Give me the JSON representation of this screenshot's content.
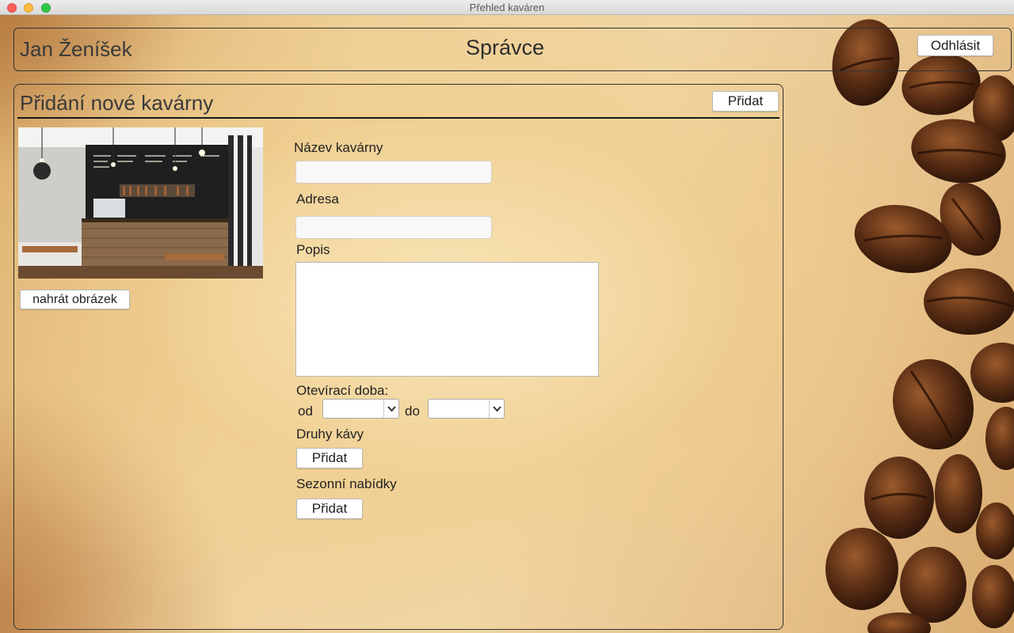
{
  "window": {
    "title": "Přehled kaváren"
  },
  "header": {
    "user_name": "Jan Ženíšek",
    "role": "Správce",
    "logout_label": "Odhlásit"
  },
  "form": {
    "title": "Přidání nové kavárny",
    "add_label": "Přidat",
    "upload_label": "nahrát obrázek",
    "name_label": "Název kavárny",
    "name_value": "",
    "address_label": "Adresa",
    "address_value": "",
    "description_label": "Popis",
    "description_value": "",
    "hours_label": "Otevírací doba:",
    "from_label": "od",
    "to_label": "do",
    "from_value": "",
    "to_value": "",
    "coffee_types_label": "Druhy kávy",
    "coffee_add_label": "Přidat",
    "seasonal_label": "Sezonní nabídky",
    "seasonal_add_label": "Přidat"
  },
  "icons": {
    "photo": "cafe-interior-photo",
    "chevron": "chevron-down-icon"
  },
  "colors": {
    "border": "#333333",
    "paper": "#f0d6a4",
    "bean": "#5a2e14"
  }
}
